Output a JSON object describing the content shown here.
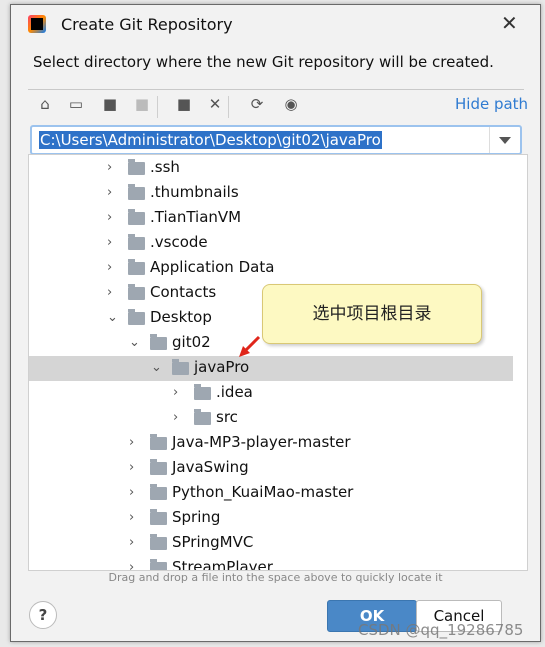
{
  "window": {
    "title": "Create Git Repository",
    "description": "Select directory where the new Git repository will be created."
  },
  "toolbar": {
    "icons": [
      "home-icon",
      "desktop-icon",
      "project-folder-icon",
      "module-folder-icon",
      "new-folder-icon",
      "delete-icon",
      "refresh-icon",
      "show-hidden-icon"
    ],
    "hide_path": "Hide path"
  },
  "path": {
    "value": "C:\\Users\\Administrator\\Desktop\\git02\\javaPro"
  },
  "tree": [
    {
      "label": ".ssh",
      "level": 1,
      "expanded": false
    },
    {
      "label": ".thumbnails",
      "level": 1,
      "expanded": false
    },
    {
      "label": ".TianTianVM",
      "level": 1,
      "expanded": false
    },
    {
      "label": ".vscode",
      "level": 1,
      "expanded": false
    },
    {
      "label": "Application Data",
      "level": 1,
      "expanded": false
    },
    {
      "label": "Contacts",
      "level": 1,
      "expanded": false
    },
    {
      "label": "Desktop",
      "level": 1,
      "expanded": true
    },
    {
      "label": "git02",
      "level": 2,
      "expanded": true
    },
    {
      "label": "javaPro",
      "level": 3,
      "expanded": true,
      "selected": true
    },
    {
      "label": ".idea",
      "level": 4,
      "expanded": false
    },
    {
      "label": "src",
      "level": 4,
      "expanded": false
    },
    {
      "label": "Java-MP3-player-master",
      "level": 2,
      "expanded": false
    },
    {
      "label": "JavaSwing",
      "level": 2,
      "expanded": false
    },
    {
      "label": "Python_KuaiMao-master",
      "level": 2,
      "expanded": false
    },
    {
      "label": "Spring",
      "level": 2,
      "expanded": false
    },
    {
      "label": "SPringMVC",
      "level": 2,
      "expanded": false
    },
    {
      "label": "StreamPlayer",
      "level": 2,
      "expanded": false
    }
  ],
  "callout": "选中项目根目录",
  "hint": "Drag and drop a file into the space above to quickly locate it",
  "buttons": {
    "help": "?",
    "ok": "OK",
    "cancel": "Cancel"
  },
  "watermark": "CSDN @qq_19286785"
}
